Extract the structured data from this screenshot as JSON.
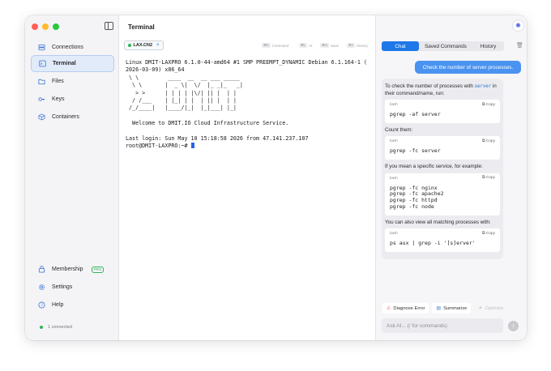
{
  "sidebar": {
    "nav": [
      {
        "label": "Connections",
        "icon": "server-icon"
      },
      {
        "label": "Terminal",
        "icon": "terminal-icon",
        "active": true
      },
      {
        "label": "Files",
        "icon": "folder-icon"
      },
      {
        "label": "Keys",
        "icon": "key-icon"
      },
      {
        "label": "Containers",
        "icon": "box-icon"
      }
    ],
    "bottom_nav": [
      {
        "label": "Membership",
        "icon": "lock-icon",
        "badge": "PRO"
      },
      {
        "label": "Settings",
        "icon": "gear-icon"
      },
      {
        "label": "Help",
        "icon": "help-icon"
      }
    ],
    "status": "1 connected"
  },
  "terminal": {
    "title": "Terminal",
    "tab_label": "LAX.CN2",
    "shortcuts": [
      {
        "key": "⌘K",
        "label": "Command"
      },
      {
        "key": "⌘L",
        "label": "AI"
      },
      {
        "key": "⌘N",
        "label": "Save"
      },
      {
        "key": "⌘J",
        "label": "History"
      }
    ],
    "output": "Linux DMIT-LAXPRO 6.1.0-44-amd64 #1 SMP PREEMPT_DYNAMIC Debian 6.1.164-1 (\n2026-03-09) x86_64\n \\ \\         ____  __  __ ___ _____ \n  \\ \\       |  _ \\|  \\/  |_ _|_   _|\n   > >      | | | | |\\/| || |  | |  \n  / /___    | |_| | |  | || |  | |  \n /_/____|   |____/|_|  |_|___| |_|  \n\n  Welcome to DMIT.IO Cloud Infrastructure Service.\n\nLast login: Sun May 10 15:18:58 2026 from 47.141.237.107\nroot@DMIT-LAXPRO:~# "
  },
  "ai_panel": {
    "tabs": [
      "Chat",
      "Saved Commands",
      "History"
    ],
    "active_tab": "Chat",
    "user_message": "Check the number of server processes.",
    "response": {
      "intro_pre": "To check the number of processes with ",
      "intro_code": "server",
      "intro_post": " in their command/name, run:",
      "blocks": [
        {
          "lang": "bash",
          "copy": "Copy",
          "code": "pgrep -af server"
        },
        {
          "lang": "bash",
          "copy": "Copy",
          "code": "pgrep -fc server"
        },
        {
          "lang": "bash",
          "copy": "Copy",
          "code": "pgrep -fc nginx\npgrep -fc apache2\npgrep -fc httpd\npgrep -fc node"
        },
        {
          "lang": "bash",
          "copy": "Copy",
          "code": "ps aux | grep -i '[s]erver'"
        }
      ],
      "count_text": "Count them:",
      "specific_text": "If you mean a specific service, for example:",
      "view_text": "You can also view all matching processes with:"
    },
    "actions": [
      "Diagnose Error",
      "Summarize",
      "Optimize"
    ],
    "ask_placeholder": "Ask AI... (/ for commands)",
    "colors": {
      "accent": "#1e78e8",
      "user_bubble": "#4a93f0",
      "ok": "#34b35a"
    }
  }
}
